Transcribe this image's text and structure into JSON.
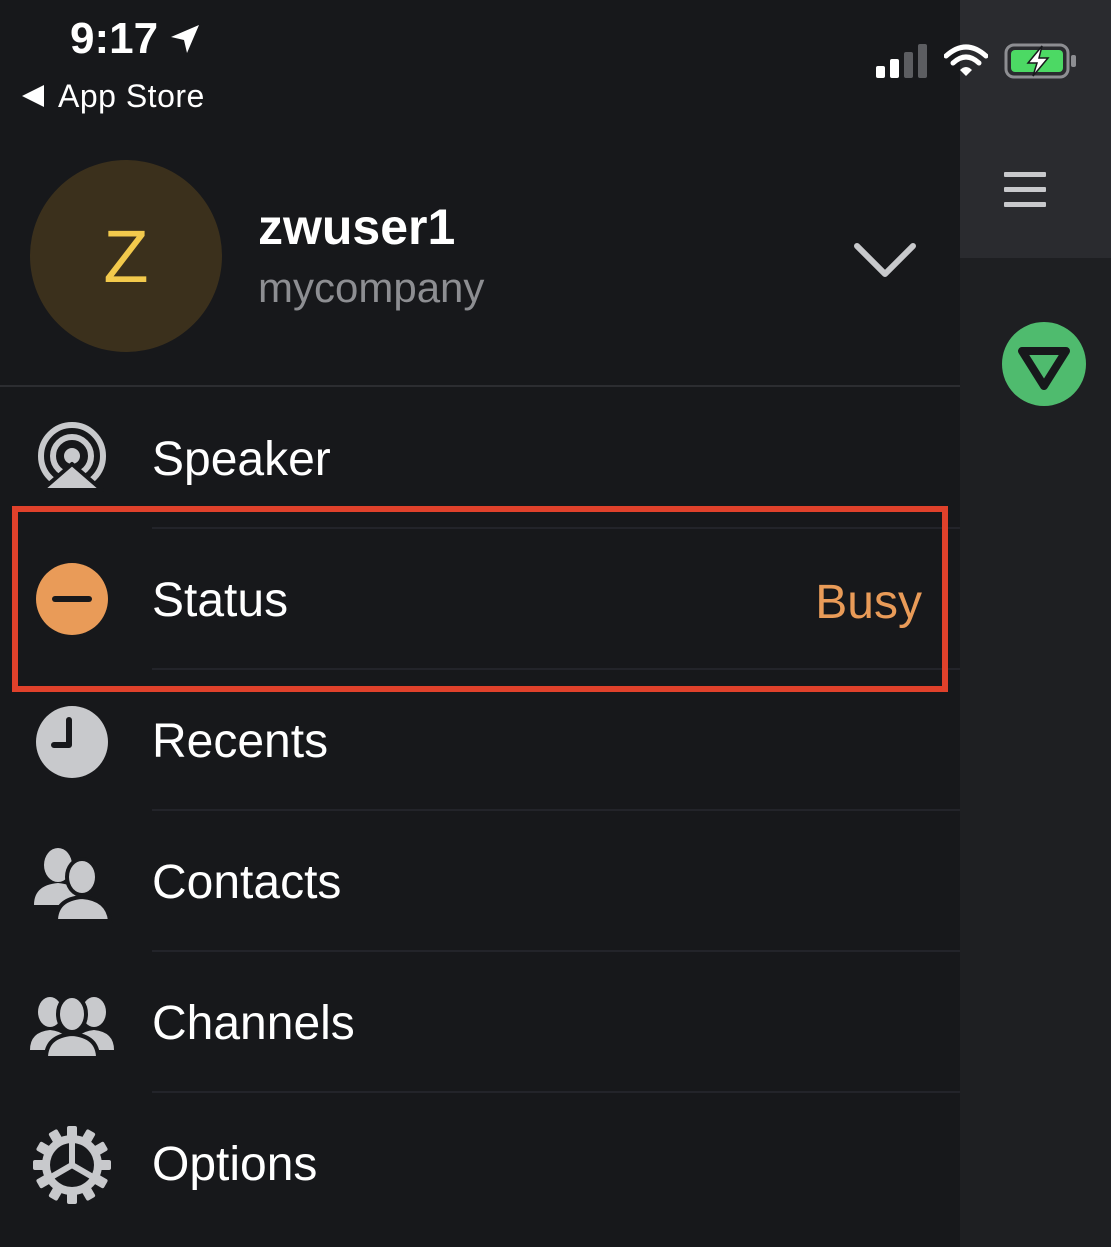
{
  "status_bar": {
    "time": "9:17",
    "back_app": "App Store"
  },
  "profile": {
    "avatar_letter": "Z",
    "username": "zwuser1",
    "company": "mycompany"
  },
  "menu": {
    "items": [
      {
        "label": "Speaker",
        "icon": "speaker-broadcast-icon"
      },
      {
        "label": "Status",
        "value": "Busy",
        "icon": "busy-status-icon"
      },
      {
        "label": "Recents",
        "icon": "clock-icon"
      },
      {
        "label": "Contacts",
        "icon": "contacts-icon"
      },
      {
        "label": "Channels",
        "icon": "channels-group-icon"
      },
      {
        "label": "Options",
        "icon": "gear-icon"
      }
    ]
  },
  "colors": {
    "background": "#17181b",
    "busy_accent": "#e99b58",
    "avatar_bg": "#3b301c",
    "avatar_letter": "#f2c94c",
    "highlight_box": "#e0412b",
    "zello_green": "#4fbb6e",
    "battery_green": "#4cd964"
  }
}
